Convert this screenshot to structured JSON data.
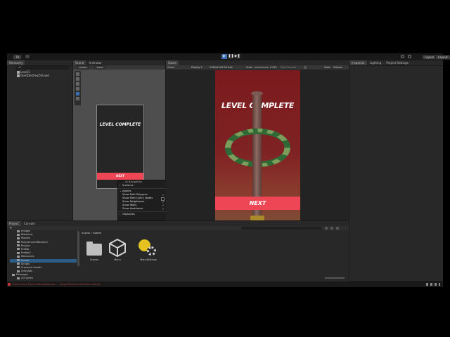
{
  "toolbar": {
    "account_label": "TR",
    "layers_label": "Layers",
    "layout_label": "Layout"
  },
  "hierarchy": {
    "tab": "Hierarchy",
    "search_placeholder": "All",
    "items": [
      "Level1",
      "DontDestroyOnLoad"
    ]
  },
  "scene": {
    "tabs": [
      "Scene",
      "Animator"
    ],
    "toolbar": [
      "Center",
      "Local"
    ],
    "preview_title": "LEVEL COMPLETE",
    "preview_button": "NEXT"
  },
  "ai_navigation": {
    "title": "AI Navigation",
    "surfaces": "Surfaces",
    "agents": "Agents",
    "options": [
      {
        "label": "Show Path Polygons",
        "checked": true
      },
      {
        "label": "Show Path Query Nodes",
        "checked": false
      },
      {
        "label": "Show Neighbours",
        "checked": true
      },
      {
        "label": "Show Walls",
        "checked": true
      },
      {
        "label": "Show Avoidance",
        "checked": true
      }
    ],
    "obstacles": "Obstacles"
  },
  "game": {
    "tab": "Game",
    "mode": "Game",
    "display": "Display 1",
    "resolution": "2560x1440 Portrait",
    "scale_label": "Scale",
    "scale_value": "0.25x",
    "play_focused": "Play Focused",
    "stats": "Stats",
    "gizmos": "Gizmos",
    "title": "LEVEL COMPLETE",
    "button": "NEXT",
    "colors": {
      "background": "#7c1d1f",
      "button": "#ef4656",
      "ring_a": "#2f6a36",
      "ring_b": "#89a864",
      "pole": "#6e4b46"
    }
  },
  "right_panel": {
    "tabs": [
      "Inspector",
      "Lighting",
      "Project Settings"
    ]
  },
  "project": {
    "tabs": [
      "Project",
      "Console"
    ],
    "breadcrumb": [
      "Assets",
      "Scene"
    ],
    "tree": [
      "Images",
      "Materials",
      "Models",
      "PlayServicesResolver",
      "Plugins",
      "Prefab",
      "Prefab2",
      "Resources",
      "Scene",
      "Scripts",
      "Standard Assets",
      "UnityAds"
    ],
    "packages_label": "Packages",
    "packages_child": "2D Sprite",
    "assets": [
      {
        "label": "Scenes",
        "icon": "folder-icon"
      },
      {
        "label": "Menu",
        "icon": "unity-scene-icon"
      },
      {
        "label": "MenuSettings",
        "icon": "lighting-settings-icon"
      }
    ]
  },
  "status_bar": {
    "message": "Failed to find PlayerSettingsResolver ... GooglePlayServices/Editor module"
  }
}
